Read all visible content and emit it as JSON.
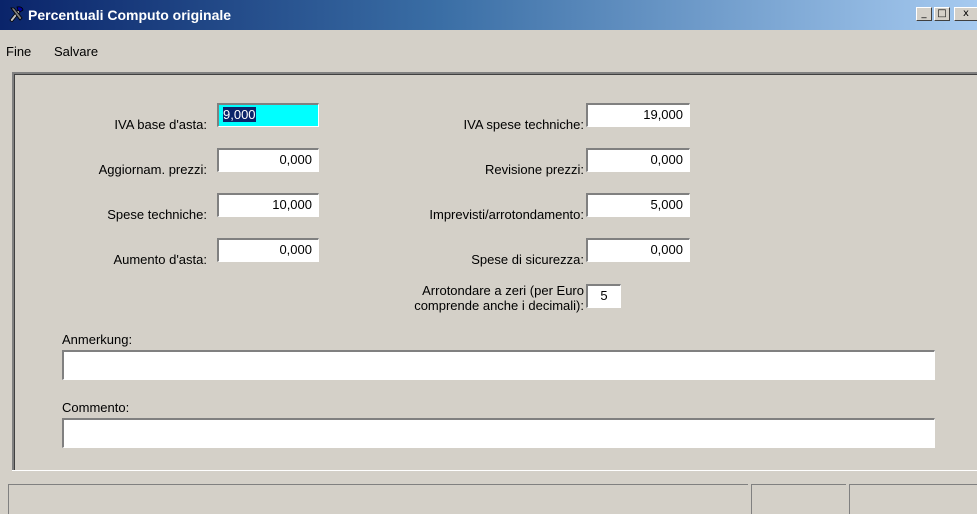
{
  "window": {
    "title": "Percentuali Computo originale",
    "icon": "app-tools-icon",
    "buttons": {
      "minimize": "_",
      "maximize": "□",
      "close": "x"
    }
  },
  "menu": {
    "items": [
      "Fine",
      "Salvare"
    ]
  },
  "form": {
    "iva_base_asta": {
      "label": "IVA base d'asta:",
      "value": "9,000"
    },
    "aggiornam_prezzi": {
      "label": "Aggiornam. prezzi:",
      "value": "0,000"
    },
    "spese_techniche": {
      "label": "Spese techniche:",
      "value": "10,000"
    },
    "aumento_asta": {
      "label": "Aumento d'asta:",
      "value": "0,000"
    },
    "iva_spese_techniche": {
      "label": "IVA spese techniche:",
      "value": "19,000"
    },
    "revisione_prezzi": {
      "label": "Revisione prezzi:",
      "value": "0,000"
    },
    "imprevisti": {
      "label": "Imprevisti/arrotondamento:",
      "value": "5,000"
    },
    "spese_sicurezza": {
      "label": "Spese di sicurezza:",
      "value": "0,000"
    },
    "arrotondare": {
      "label_line1": "Arrotondare a zeri (per Euro",
      "label_line2": "comprende anche i decimali):",
      "value": "5"
    },
    "anmerkung": {
      "label": "Anmerkung:",
      "value": ""
    },
    "commento": {
      "label": "Commento:",
      "value": ""
    }
  },
  "colors": {
    "focused_field": "#00ffff",
    "titlebar_start": "#0a246a",
    "titlebar_end": "#a6caf0"
  }
}
